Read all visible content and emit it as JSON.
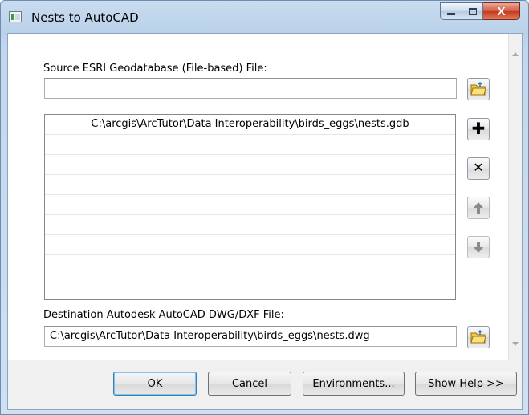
{
  "window": {
    "title": "Nests to AutoCAD",
    "close_glyph": "X"
  },
  "form": {
    "source_label": "Source ESRI Geodatabase (File-based) File:",
    "source_value": "",
    "source_list": [
      "C:\\arcgis\\ArcTutor\\Data Interoperability\\birds_eggs\\nests.gdb",
      "",
      "",
      "",
      "",
      "",
      "",
      "",
      ""
    ],
    "destination_label": "Destination Autodesk AutoCAD DWG/DXF File:",
    "destination_value": "C:\\arcgis\\ArcTutor\\Data Interoperability\\birds_eggs\\nests.dwg"
  },
  "list_tools": {
    "add_glyph": "✚",
    "remove_glyph": "✕",
    "up_glyph": "🡑",
    "down_glyph": "🡓"
  },
  "buttons": {
    "ok": "OK",
    "cancel": "Cancel",
    "environments": "Environments...",
    "show_help": "Show Help >>"
  },
  "icons": {
    "browse": "open-folder-icon",
    "add": "plus-icon",
    "remove": "x-icon",
    "up": "arrow-up-icon",
    "down": "arrow-down-icon"
  },
  "colors": {
    "title_bar": "#c4d9ef",
    "close_button": "#c9452a",
    "folder": "#f5c842",
    "disabled_arrow": "#8a8a8a"
  }
}
